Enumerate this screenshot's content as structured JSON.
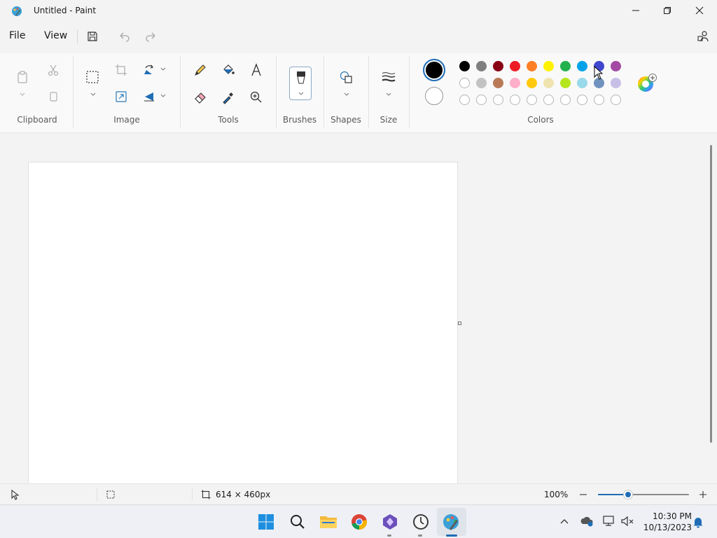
{
  "window": {
    "title": "Untitled - Paint"
  },
  "menu": {
    "file": "File",
    "view": "View"
  },
  "ribbon": {
    "groups": {
      "clipboard": "Clipboard",
      "image": "Image",
      "tools": "Tools",
      "brushes": "Brushes",
      "shapes": "Shapes",
      "size": "Size",
      "colors": "Colors"
    },
    "primary_color": "#000000",
    "secondary_color": "#ffffff",
    "palette": {
      "row1": [
        "#000000",
        "#7f7f7f",
        "#880015",
        "#ed1c24",
        "#ff7f27",
        "#fff200",
        "#22b14c",
        "#00a2e8",
        "#3f48cc",
        "#a349a4"
      ],
      "row2": [
        "#ffffff",
        "#c3c3c3",
        "#b97a57",
        "#ffaec9",
        "#ffc90e",
        "#efe4b0",
        "#b5e61d",
        "#99d9ea",
        "#7092be",
        "#c8bfe7"
      ]
    }
  },
  "status": {
    "canvas_size": "614 × 460px",
    "zoom": "100%",
    "zoom_fraction": 0.33
  },
  "taskbar": {
    "time": "10:30 PM",
    "date": "10/13/2023"
  }
}
